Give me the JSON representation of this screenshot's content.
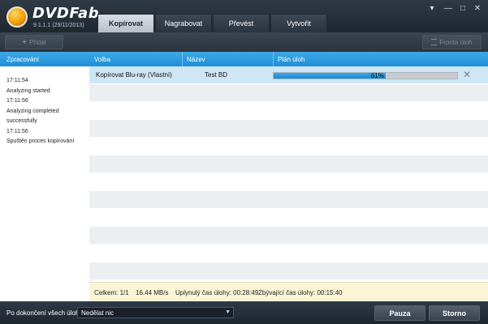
{
  "app": {
    "brand": "DVDFab",
    "version": "9.1.1.1 (29/11/2013)"
  },
  "tabs": [
    {
      "label": "Kopírovat",
      "active": true
    },
    {
      "label": "Nagrabovat",
      "active": false
    },
    {
      "label": "Převést",
      "active": false
    },
    {
      "label": "Vytvořit",
      "active": false
    }
  ],
  "window_controls": {
    "menu": "▾",
    "minimize": "—",
    "maximize": "□",
    "close": "✕"
  },
  "toolbar": {
    "add_label": "Přidat",
    "add_icon": "+",
    "queue_label": "Fronta úloh"
  },
  "left_panel": {
    "header": "Zpracování",
    "log": [
      "17:11:54",
      "Analyzing started",
      "17:11:56",
      "Analyzing completed successfully",
      "17:11:56",
      "Spuštěn proces kopírování"
    ]
  },
  "grid": {
    "headers": {
      "mode": "Volba",
      "name": "Název",
      "plan": "Plán úloh"
    },
    "selected_row": {
      "mode": "Kopírovat Blu-ray (Vlastní)",
      "name": "Test BD",
      "progress_percent": 61,
      "progress_label": "61%",
      "remove_icon": "✕"
    }
  },
  "status": {
    "total": "Celkem: 1/1",
    "speed": "16.44 MB/s",
    "elapsed": "Uplynulý čas úlohy: 00:28:49",
    "remaining": "Zbývající čas úlohy: 00:15:40"
  },
  "footer": {
    "after_label": "Po dokončení všech úloh:",
    "after_value": "Nedělat nic",
    "pause_label": "Pauza",
    "cancel_label": "Storno"
  }
}
